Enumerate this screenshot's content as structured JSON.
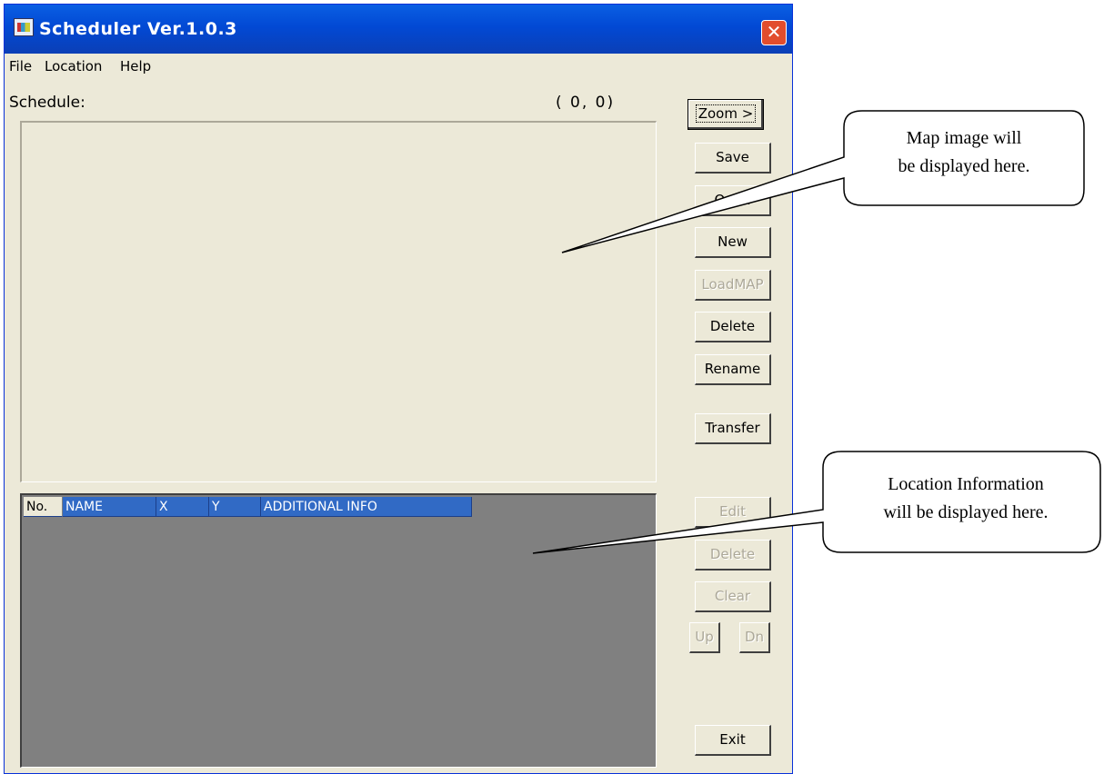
{
  "window": {
    "title": "Scheduler Ver.1.0.3",
    "close_symbol": "✕"
  },
  "menu": [
    "File",
    "Location",
    "Help"
  ],
  "schedule_label": "Schedule:",
  "coordinates": "( 0, 0)",
  "buttons": {
    "zoom": "Zoom >",
    "save": "Save",
    "open": "Open",
    "new": "New",
    "loadmap": "LoadMAP",
    "delete": "Delete",
    "rename": "Rename",
    "transfer": "Transfer",
    "edit": "Edit",
    "delete2": "Delete",
    "clear": "Clear",
    "up": "Up",
    "dn": "Dn",
    "exit": "Exit"
  },
  "table": {
    "columns": [
      "No.",
      "NAME",
      "X",
      "Y",
      "ADDITIONAL INFO"
    ]
  },
  "callouts": {
    "map": [
      "Map image will",
      "be displayed here."
    ],
    "location": [
      "Location Information",
      "will be displayed here."
    ]
  },
  "icons": {
    "app": "app-icon",
    "close": "close-icon"
  }
}
